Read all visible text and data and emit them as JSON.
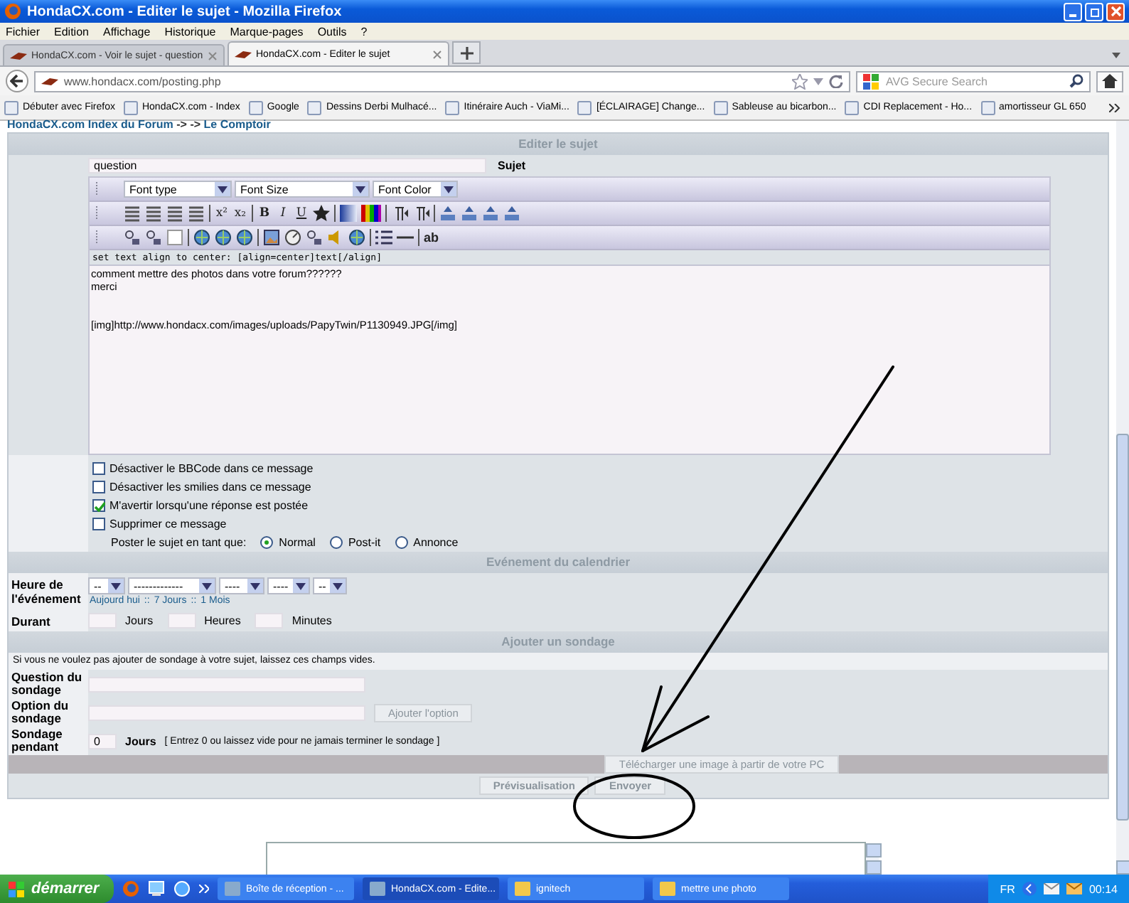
{
  "window": {
    "title": "HondaCX.com - Editer le sujet - Mozilla Firefox"
  },
  "menu": [
    "Fichier",
    "Edition",
    "Affichage",
    "Historique",
    "Marque-pages",
    "Outils",
    "?"
  ],
  "tabs": [
    {
      "label": "HondaCX.com - Voir le sujet - question",
      "selected": false
    },
    {
      "label": "HondaCX.com - Editer le sujet",
      "selected": true
    }
  ],
  "address_bar": {
    "url": "www.hondacx.com/posting.php",
    "search_placeholder": "AVG Secure Search"
  },
  "bookmarks": [
    "Débuter avec Firefox",
    "HondaCX.com - Index",
    "Google",
    "Dessins Derbi Mulhacé...",
    "Itinéraire Auch - ViaMi...",
    "[ÉCLAIRAGE] Change...",
    "Sableuse au bicarbon...",
    "CDI Replacement - Ho...",
    "amortisseur GL 650"
  ],
  "breadcrumb": {
    "index_link": "HondaCX.com Index du Forum",
    "separator": "-> ->",
    "forum_link": "Le Comptoir"
  },
  "edit_section": {
    "header": "Editer le sujet",
    "subject_value": "question",
    "subject_label": "Sujet",
    "font_selects": [
      "Font type",
      "Font Size",
      "Font Color"
    ],
    "format_buttons": [
      "x²",
      "x₂",
      "B",
      "I",
      "U"
    ],
    "spell_button": "ab",
    "help_line": "set text align to center: [align=center]text[/align]",
    "message_paragraphs": [
      [
        "comment mettre des photos dans votre forum??????",
        "merci"
      ],
      [
        "[img]http://www.hondacx.com/images/uploads/PapyTwin/P1130949.JPG[/img]"
      ]
    ],
    "options": [
      {
        "label": "Désactiver le BBCode dans ce message",
        "checked": false
      },
      {
        "label": "Désactiver les smilies dans ce message",
        "checked": false
      },
      {
        "label": "M'avertir lorsqu'une réponse est postée",
        "checked": true
      },
      {
        "label": "Supprimer ce message",
        "checked": false
      }
    ],
    "post_as_label": "Poster le sujet en tant que:",
    "post_types": [
      {
        "label": "Normal",
        "selected": true
      },
      {
        "label": "Post-it",
        "selected": false
      },
      {
        "label": "Annonce",
        "selected": false
      }
    ]
  },
  "calendar": {
    "header": "Evénement du calendrier",
    "time_label": "Heure de l'événement",
    "time_selects": [
      "--",
      "-------------",
      "----",
      "----",
      "--"
    ],
    "quick_links": [
      "Aujourd hui",
      "7 Jours",
      "1 Mois"
    ],
    "link_separator": "::",
    "duration_label": "Durant",
    "duration_units": [
      "Jours",
      "Heures",
      "Minutes"
    ]
  },
  "poll": {
    "header": "Ajouter un sondage",
    "note": "Si vous ne voulez pas ajouter de sondage à votre sujet, laissez ces champs vides.",
    "question_label": "Question du sondage",
    "option_label": "Option du sondage",
    "add_option_button": "Ajouter l'option",
    "length_label": "Sondage pendant",
    "days_value": "0",
    "days_label": "Jours",
    "days_hint": "[ Entrez 0 ou laissez vide pour ne jamais terminer le sondage ]"
  },
  "upload_button": "Télécharger une image à partir de votre PC",
  "buttons": [
    "Prévisualisation",
    "Envoyer"
  ],
  "taskbar": {
    "start": "démarrer",
    "tasks": [
      {
        "label": "Boîte de réception - ...",
        "selected": false
      },
      {
        "label": "HondaCX.com - Edite...",
        "selected": true
      },
      {
        "label": "ignitech",
        "selected": false
      },
      {
        "label": "mettre une photo",
        "selected": false
      }
    ],
    "language": "FR",
    "clock": "00:14"
  }
}
